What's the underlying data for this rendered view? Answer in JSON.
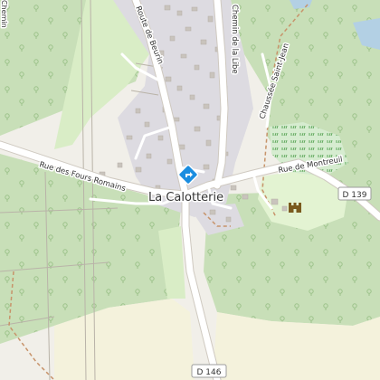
{
  "map": {
    "place_label": "La Calotterie",
    "road_labels": {
      "route_de_beurin": "Route de Beurin",
      "chemin_de_la_lib": "Chemin de la Libe",
      "chaussee_saint_jean": "Chaussée Saint-Jean",
      "rue_de_montreuil": "Rue de Montreuil",
      "rue_des_fours_romains": "Rue des Fours Romains",
      "edge_road": "Chemin"
    },
    "road_refs": {
      "d139": "D 139",
      "d146": "D 146"
    },
    "icons": {
      "town_hall": "townhall-diamond-icon",
      "castle": "castle-icon"
    },
    "colors": {
      "forest": "#c8dfb8",
      "meadow": "#d9edc6",
      "farmland": "#f4f2dc",
      "residential": "#dddbe1",
      "road": "#ffffff",
      "wetland": "#88c079",
      "water": "#b3d0e4",
      "pin": "#1b8de0"
    }
  }
}
